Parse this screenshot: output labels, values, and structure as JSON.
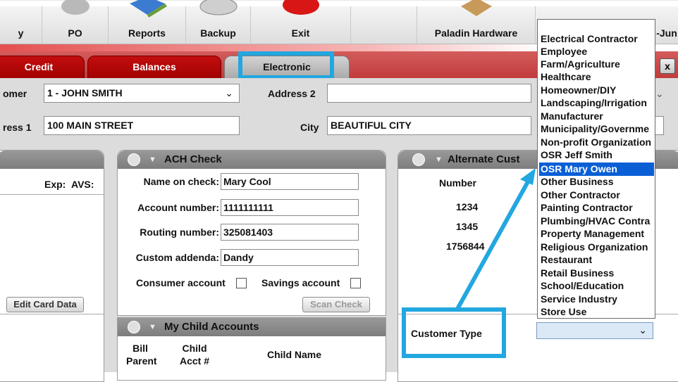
{
  "toolbar": {
    "items": [
      "y",
      "PO",
      "Reports",
      "Backup",
      "Exit",
      "Paladin Hardware",
      "-Jun"
    ]
  },
  "tabs": {
    "credit": "Credit",
    "balances": "Balances",
    "electronic": "Electronic",
    "close": "x"
  },
  "form": {
    "customer_label": "omer",
    "customer_value": "1 - JOHN SMITH",
    "address1_label": "ress 1",
    "address1_value": "100 MAIN STREET",
    "address2_label": "Address 2",
    "address2_value": "",
    "city_label": "City",
    "city_value": "BEAUTIFUL CITY"
  },
  "left_panel": {
    "exp": "Exp:",
    "avs": "AVS:",
    "edit_button": "Edit Card Data"
  },
  "ach": {
    "title": "ACH Check",
    "rows": [
      {
        "label": "Name on check:",
        "value": "Mary Cool"
      },
      {
        "label": "Account number:",
        "value": "1111111111"
      },
      {
        "label": "Routing number:",
        "value": "325081403"
      },
      {
        "label": "Custom addenda:",
        "value": "Dandy"
      }
    ],
    "consumer_account": "Consumer account",
    "savings_account": "Savings account",
    "scan_button": "Scan Check"
  },
  "child_accounts": {
    "title": "My Child Accounts",
    "col1": "Bill Parent",
    "col2": "Child Acct #",
    "col3": "Child Name",
    "col1a": "Bill",
    "col1b": "Parent",
    "col2a": "Child",
    "col2b": "Acct #"
  },
  "alternate": {
    "title": "Alternate Cust",
    "number_header": "Number",
    "numbers": [
      "1234",
      "1345",
      "1756844"
    ]
  },
  "customer_type": {
    "label": "Customer Type",
    "value": "",
    "options": [
      "Electrical Contractor",
      "Employee",
      "Farm/Agriculture",
      "Healthcare",
      "Homeowner/DIY",
      "Landscaping/Irrigation",
      "Manufacturer",
      "Municipality/Governme",
      "Non-profit Organization",
      "OSR Jeff Smith",
      "OSR Mary Owen",
      "Other Business",
      "Other Contractor",
      "Painting Contractor",
      "Plumbing/HVAC Contra",
      "Property Management",
      "Religious Organization",
      "Restaurant",
      "Retail Business",
      "School/Education",
      "Service Industry",
      "Store Use"
    ],
    "selected": "OSR Mary Owen"
  },
  "colors": {
    "highlight": "#22a7e0",
    "selected": "#0a5fd6",
    "tab_red": "#b00505"
  }
}
